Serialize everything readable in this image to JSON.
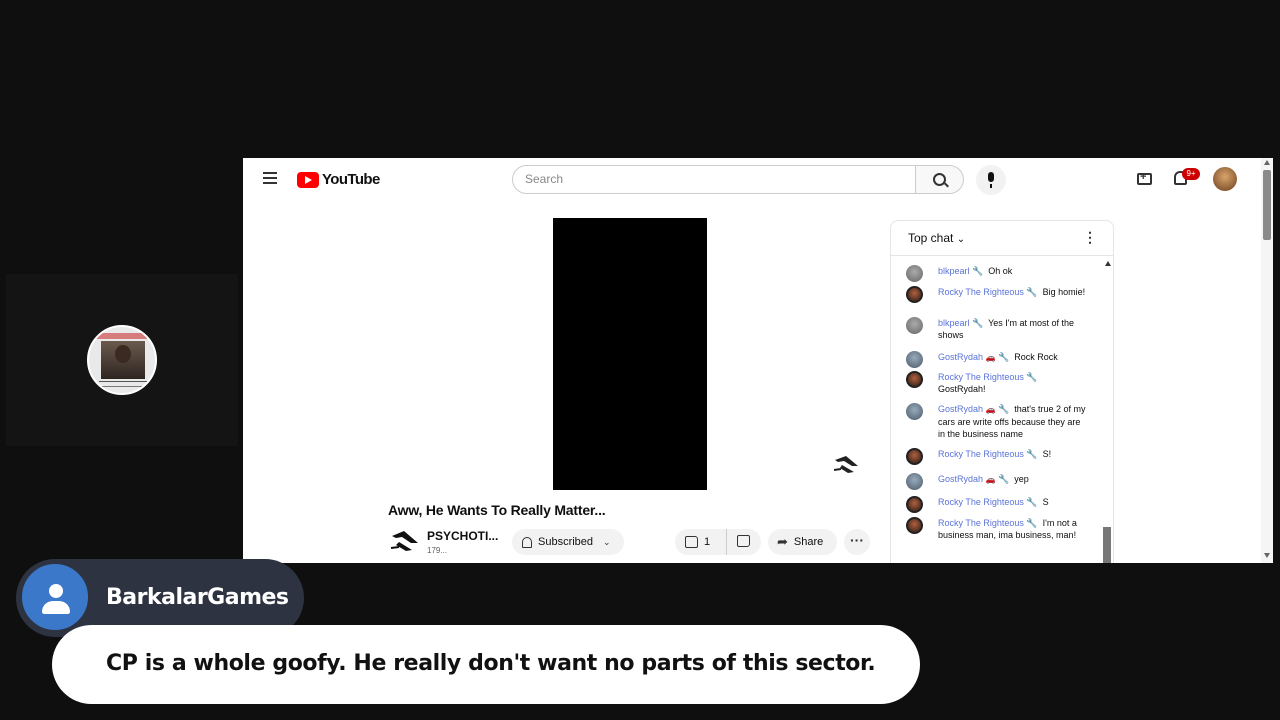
{
  "youtube": {
    "logo_text": "YouTube",
    "search_placeholder": "Search",
    "notification_count": "9+",
    "video": {
      "title": "Aww, He Wants To Really Matter...",
      "channel_name": "PSYCHOTI...",
      "channel_subs": "179...",
      "subscribe_label": "Subscribed",
      "like_count": "1",
      "share_label": "Share",
      "more_label": "···"
    },
    "chat": {
      "title": "Top chat",
      "messages": [
        {
          "author": "blkpearl",
          "text": "Oh ok"
        },
        {
          "author": "Rocky The Righteous",
          "text": "Big homie!"
        },
        {
          "author": "blkpearl",
          "text": "Yes I'm at most of the shows"
        },
        {
          "author": "GostRydah",
          "text": "Rock Rock"
        },
        {
          "author": "Rocky The Righteous",
          "text": "GostRydah!"
        },
        {
          "author": "GostRydah",
          "text": "that's true 2 of my cars are write offs because they are in the business name"
        },
        {
          "author": "Rocky The Righteous",
          "text": "S!"
        },
        {
          "author": "GostRydah",
          "text": "yep"
        },
        {
          "author": "Rocky The Righteous",
          "text": "S"
        },
        {
          "author": "Rocky The Righteous",
          "text": "I'm not a business man, ima business, man!"
        }
      ]
    }
  },
  "overlay": {
    "commenter_name": "BarkalarGames",
    "comment_text": "CP is a whole goofy. He really don't want no parts of this sector."
  },
  "colors": {
    "background": "#0f0f0f",
    "youtube_red": "#ff0000",
    "chat_author": "#5a73d8",
    "chip_bg": "#2d3340",
    "avatar_blue": "#3b78c9"
  }
}
